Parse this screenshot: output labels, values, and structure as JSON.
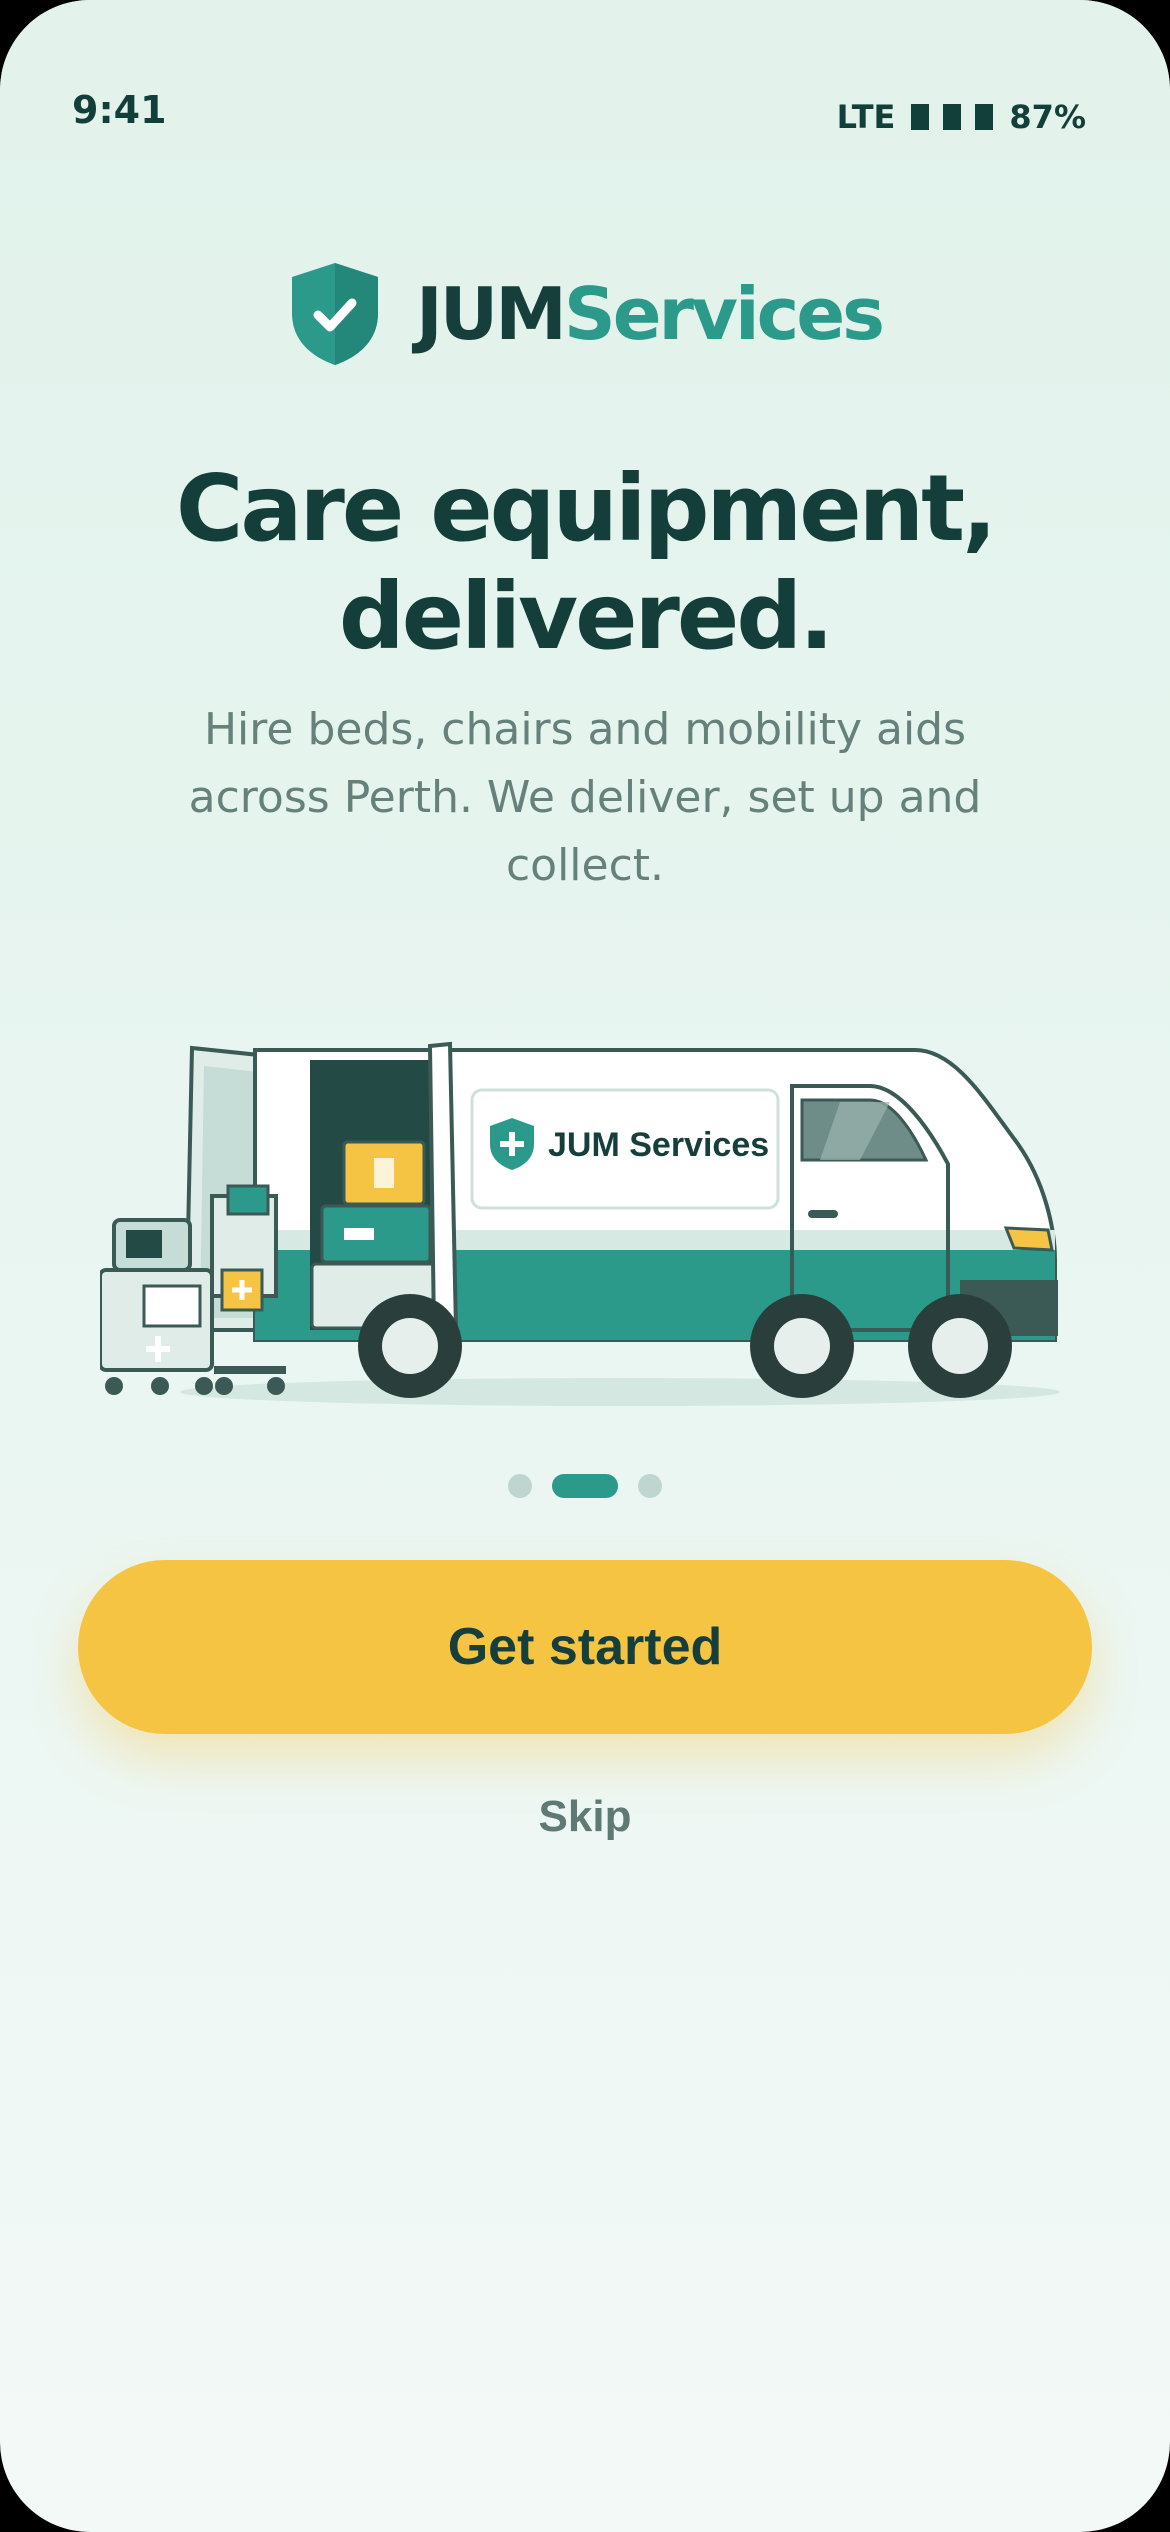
{
  "status_bar": {
    "time": "9:41",
    "network": "LTE",
    "battery": "87%"
  },
  "brand": {
    "name_part1": "JUM",
    "name_part2": "Services",
    "van_logo_text": "JUM Services",
    "colors": {
      "dark": "#163f3b",
      "teal": "#2b9a8a",
      "yellow": "#f5c443"
    }
  },
  "headline": {
    "line1": "Care equipment,",
    "line2": "delivered."
  },
  "subtext": "Hire beds, chairs and mobility aids across Perth. We deliver, set up and collect.",
  "pager": {
    "total": 3,
    "active_index": 1
  },
  "actions": {
    "primary_label": "Get started",
    "secondary_label": "Skip"
  },
  "icons": {
    "logo": "shield-check-icon"
  }
}
